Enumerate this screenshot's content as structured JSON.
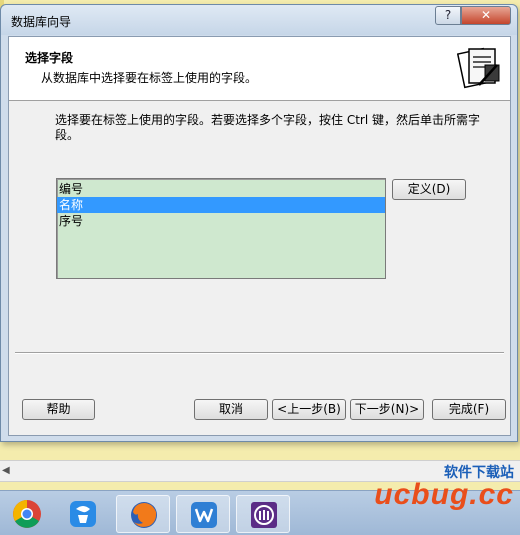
{
  "window": {
    "title": "数据库向导",
    "help_label": "?",
    "close_label": "✕"
  },
  "header": {
    "title": "选择字段",
    "subtitle": "从数据库中选择要在标签上使用的字段。"
  },
  "instruction": "选择要在标签上使用的字段。若要选择多个字段，按住 Ctrl 键，然后单击所需字段。",
  "fields": {
    "items": [
      {
        "label": "编号",
        "selected": false
      },
      {
        "label": "名称",
        "selected": true
      },
      {
        "label": "序号",
        "selected": false
      }
    ]
  },
  "buttons": {
    "define": "定义(D)",
    "help": "帮助",
    "cancel": "取消",
    "back": "<上一步(B)",
    "next": "下一步(N)>",
    "finish": "完成(F)"
  },
  "colors": {
    "list_bg": "#cfe8cf",
    "selection": "#3399ff",
    "close_button": "#c4452c"
  },
  "taskbar": {
    "items": [
      {
        "name": "chrome-icon"
      },
      {
        "name": "app-icon-blue"
      },
      {
        "name": "firefox-icon"
      },
      {
        "name": "wps-writer-icon"
      },
      {
        "name": "app-icon-purple"
      }
    ]
  },
  "watermark": {
    "site_name": "软件下载站",
    "logo_text": "ucbug.cc"
  }
}
